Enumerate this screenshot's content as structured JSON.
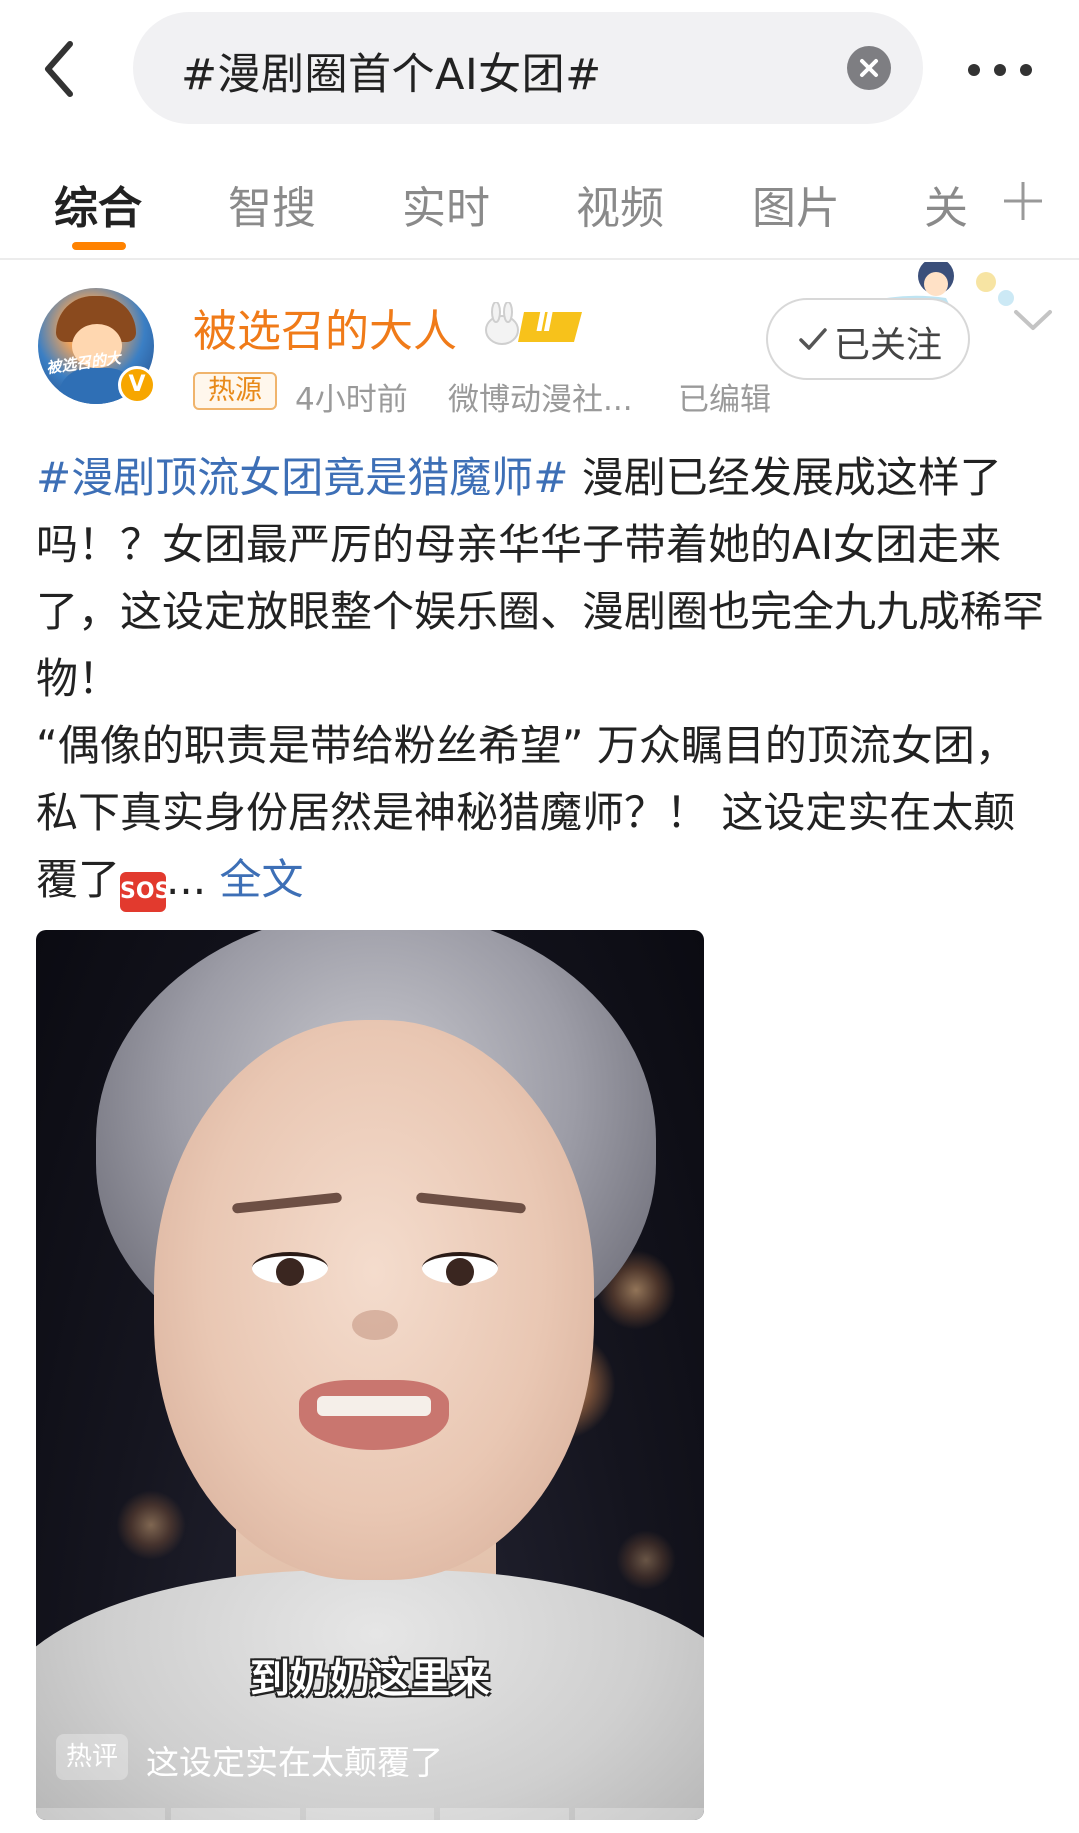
{
  "search": {
    "query": "#漫剧圈首个AI女团#"
  },
  "tabs": [
    {
      "label": "综合",
      "active": true
    },
    {
      "label": "智搜"
    },
    {
      "label": "实时"
    },
    {
      "label": "视频"
    },
    {
      "label": "图片"
    },
    {
      "label": "关"
    }
  ],
  "post": {
    "username": "被选召的大人",
    "level_badge": "Ⅱ",
    "avatar_text": "被选召的大",
    "meta": {
      "hot_tag": "热源",
      "time": "4小时前",
      "source": "微博动漫社...",
      "edited": "已编辑"
    },
    "follow_label": "已关注",
    "hashtag": "#漫剧顶流女团竟是猎魔师#",
    "text_part1": " 漫剧已经发展成这样了吗！？女团最严厉的母亲华华子带着她的AI女团走来了，这设定放眼整个娱乐圈、漫剧圈也完全九九成稀罕物！",
    "text_part2": "“偶像的职责是带给粉丝希望” 万众瞩目的顶流女团，私下真实身份居然是神秘猎魔师？！ 这设定实在太颠覆了",
    "sos_emoji": "SOS",
    "ellipsis": "...",
    "fulltext_label": "全文",
    "video": {
      "subtitle": "到奶奶这里来",
      "hot_comment_tag": "热评",
      "hot_comment_text": "这设定实在太颠覆了"
    }
  },
  "colors": {
    "accent": "#ff8200",
    "username": "#f07b19",
    "link": "#3d6fb6"
  },
  "icons": [
    "back-arrow-icon",
    "clear-icon",
    "more-icon",
    "plus-icon",
    "check-icon",
    "chevron-down-icon",
    "verified-icon"
  ]
}
